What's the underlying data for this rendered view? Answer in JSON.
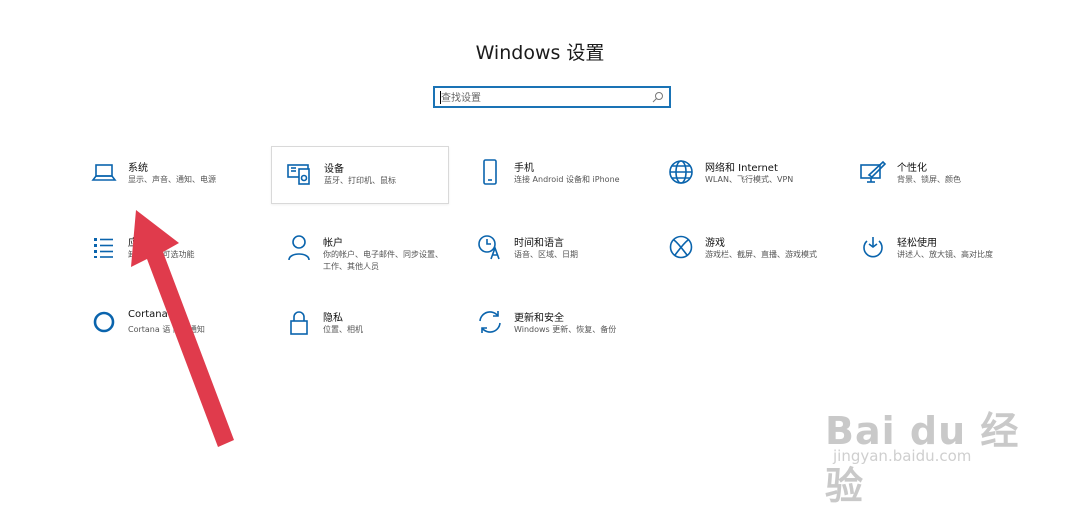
{
  "window": {
    "title": "Windows 设置"
  },
  "search": {
    "placeholder": "查找设置",
    "icon": "search-icon"
  },
  "tiles": [
    {
      "name": "系统",
      "desc": "显示、声音、通知、电源",
      "icon": "laptop-icon"
    },
    {
      "name": "设备",
      "desc": "蓝牙、打印机、鼠标",
      "icon": "devices-icon"
    },
    {
      "name": "手机",
      "desc": "连接 Android 设备和 iPhone",
      "icon": "phone-icon"
    },
    {
      "name": "网络和 Internet",
      "desc": "WLAN、飞行模式、VPN",
      "icon": "globe-icon"
    },
    {
      "name": "个性化",
      "desc": "背景、锁屏、颜色",
      "icon": "personalization-icon"
    },
    {
      "name": "应",
      "desc": "卸 应用、可选功能",
      "icon": "apps-list-icon"
    },
    {
      "name": "帐户",
      "desc": "你的帐户、电子邮件、同步设置、工作、其他人员",
      "icon": "account-icon"
    },
    {
      "name": "时间和语言",
      "desc": "语音、区域、日期",
      "icon": "time-language-icon"
    },
    {
      "name": "游戏",
      "desc": "游戏栏、截屏、直播、游戏模式",
      "icon": "xbox-icon"
    },
    {
      "name": "轻松使用",
      "desc": "讲述人、放大镜、高对比度",
      "icon": "ease-of-access-icon"
    },
    {
      "name": "Cortana",
      "desc": "Cortana 语 限、通知",
      "icon": "cortana-icon"
    },
    {
      "name": "隐私",
      "desc": "位置、相机",
      "icon": "lock-icon"
    },
    {
      "name": "更新和安全",
      "desc": "Windows 更新、恢复、备份",
      "icon": "update-icon"
    }
  ],
  "colors": {
    "accent": "#0a64ad",
    "arrow": "#e03b4c",
    "search_border": "#1a73b5"
  },
  "watermark": {
    "brand": "Bai du 经验",
    "url": "jingyan.baidu.com"
  }
}
